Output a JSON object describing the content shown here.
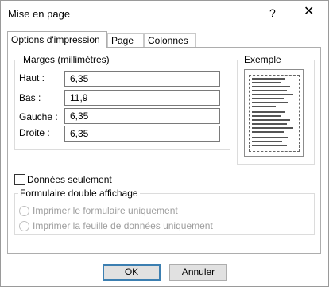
{
  "window": {
    "title": "Mise en page",
    "help_label": "?",
    "close_label": "✕"
  },
  "tabs": [
    {
      "label": "Options d'impression",
      "active": true
    },
    {
      "label": "Page",
      "active": false
    },
    {
      "label": "Colonnes",
      "active": false
    }
  ],
  "margins": {
    "group_label": "Marges (millimètres)",
    "fields": [
      {
        "label": "Haut :",
        "value": "6,35"
      },
      {
        "label": "Bas :",
        "value": "11,9"
      },
      {
        "label": "Gauche :",
        "value": "6,35"
      },
      {
        "label": "Droite :",
        "value": "6,35"
      }
    ]
  },
  "example": {
    "label": "Exemple"
  },
  "data_only": {
    "label": "Données seulement",
    "checked": false
  },
  "split_form": {
    "group_label": "Formulaire double affichage",
    "options": [
      {
        "label": "Imprimer le formulaire uniquement"
      },
      {
        "label": "Imprimer la feuille de données uniquement"
      }
    ]
  },
  "buttons": {
    "ok_label": "OK",
    "cancel_label": "Annuler"
  }
}
